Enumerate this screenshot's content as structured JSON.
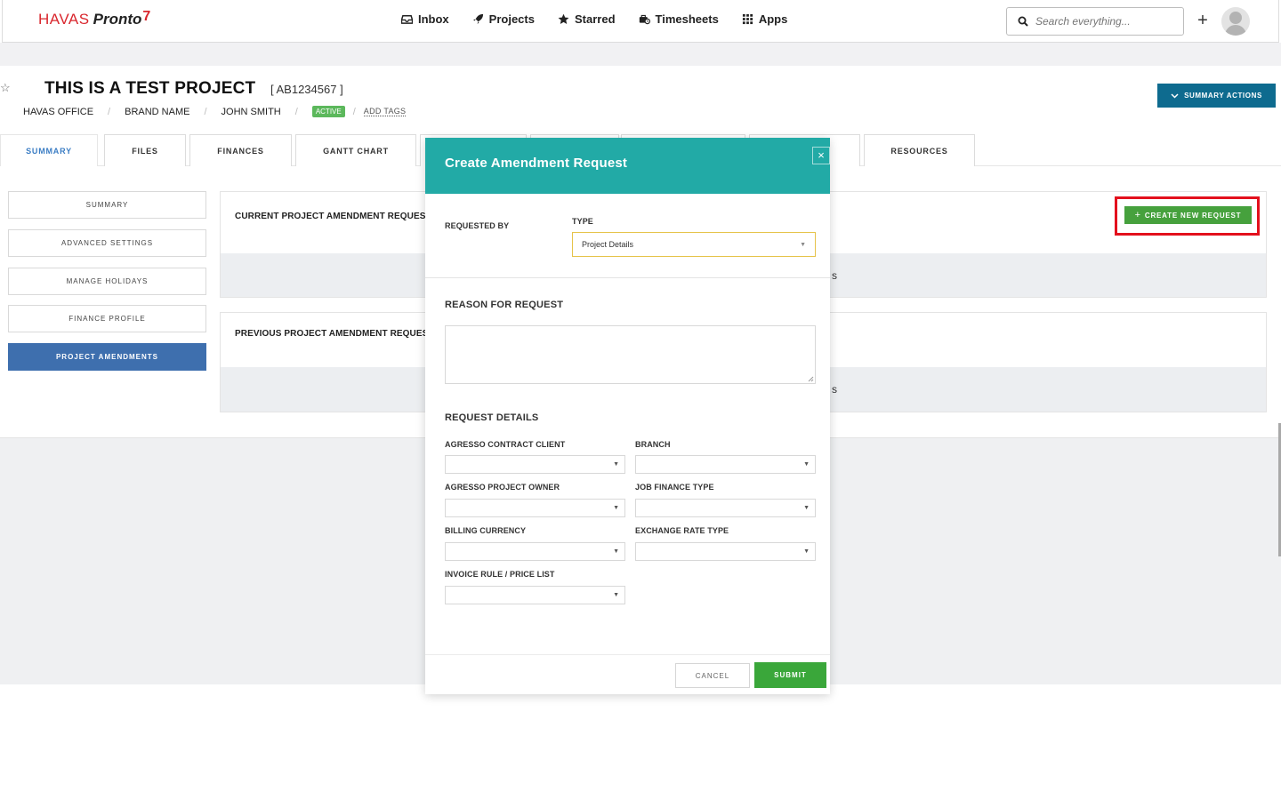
{
  "brand": {
    "havas": "HAVAS",
    "pronto": "Pronto",
    "mark": "7"
  },
  "nav": {
    "items": [
      {
        "label": "Inbox",
        "icon": "inbox-icon"
      },
      {
        "label": "Projects",
        "icon": "rocket-icon"
      },
      {
        "label": "Starred",
        "icon": "star-icon"
      },
      {
        "label": "Timesheets",
        "icon": "timesheet-icon"
      },
      {
        "label": "Apps",
        "icon": "apps-grid-icon"
      }
    ],
    "search_placeholder": "Search everything...",
    "plus": "+"
  },
  "project": {
    "star": "☆",
    "title": "THIS IS A TEST PROJECT",
    "code": "[ AB1234567 ]",
    "breadcrumbs": [
      "HAVAS OFFICE",
      "BRAND NAME",
      "JOHN SMITH"
    ],
    "status": "ACTIVE",
    "add_tags": "ADD TAGS",
    "summary_actions": "SUMMARY ACTIONS"
  },
  "tabs": [
    "SUMMARY",
    "FILES",
    "FINANCES",
    "GANTT CHART",
    "",
    "",
    "",
    "RESOURCES"
  ],
  "sidebar": {
    "items": [
      "SUMMARY",
      "ADVANCED SETTINGS",
      "MANAGE HOLIDAYS",
      "FINANCE PROFILE",
      "PROJECT AMENDMENTS"
    ]
  },
  "panels": {
    "current_title": "CURRENT PROJECT AMENDMENT REQUEST",
    "current_foot": "s",
    "previous_title": "PREVIOUS PROJECT AMENDMENT REQUEST",
    "previous_foot": "s",
    "create_new_request": "CREATE NEW REQUEST"
  },
  "modal": {
    "title": "Create Amendment Request",
    "close": "×",
    "requested_by_label": "REQUESTED BY",
    "type_label": "TYPE",
    "type_value": "Project Details",
    "reason_label": "REASON FOR REQUEST",
    "details_label": "REQUEST DETAILS",
    "fields": {
      "agresso_contract_client": "AGRESSO CONTRACT CLIENT",
      "branch": "BRANCH",
      "agresso_project_owner": "AGRESSO PROJECT OWNER",
      "job_finance_type": "JOB FINANCE TYPE",
      "billing_currency": "BILLING CURRENCY",
      "exchange_rate_type": "EXCHANGE RATE TYPE",
      "invoice_rule": "INVOICE RULE / PRICE LIST"
    },
    "cancel": "CANCEL",
    "submit": "SUBMIT"
  },
  "colors": {
    "brand_red": "#d9272e",
    "modal_header": "#22aaa6",
    "summary_actions": "#0e6b8f",
    "create_button": "#46a13d",
    "submit_button": "#3aa73a",
    "sidebar_active": "#3e6fae",
    "highlight_box": "#e3101d"
  }
}
